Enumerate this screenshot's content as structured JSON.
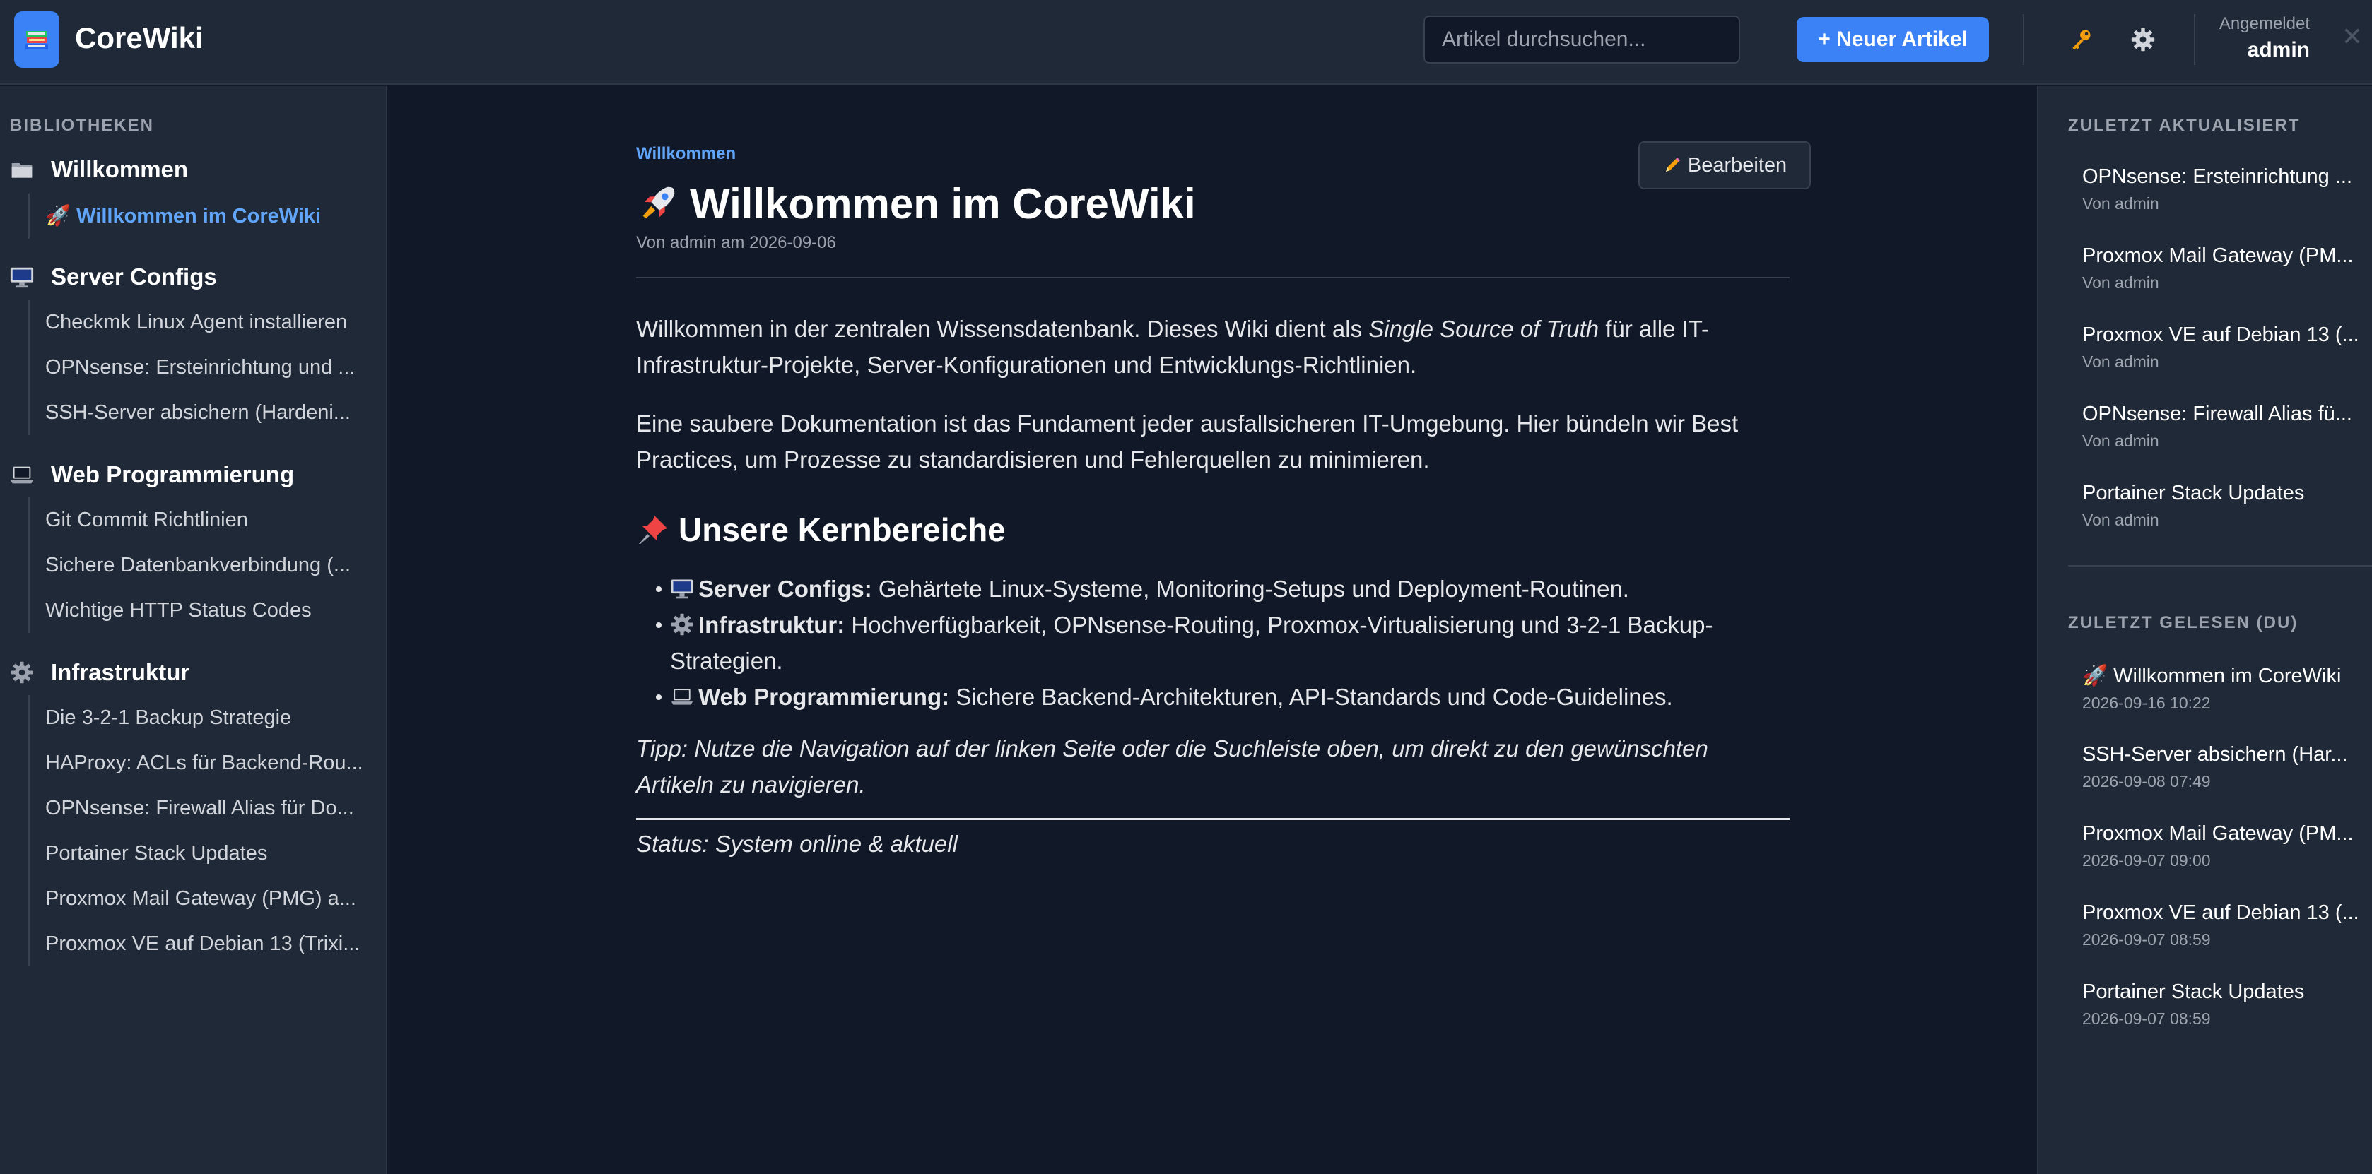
{
  "header": {
    "app_title": "CoreWiki",
    "search_placeholder": "Artikel durchsuchen...",
    "new_article_label": "+ Neuer Artikel",
    "user_caption": "Angemeldet",
    "user_name": "admin",
    "close_glyph": "✕",
    "icons": [
      "books-logo-icon",
      "key-icon",
      "gear-icon",
      "close-icon"
    ]
  },
  "sidebar": {
    "heading": "BIBLIOTHEKEN",
    "libraries": [
      {
        "title": "Willkommen",
        "icon": "folder-icon",
        "items": [
          {
            "label": "🚀 Willkommen im CoreWiki",
            "active": true
          }
        ]
      },
      {
        "title": "Server Configs",
        "icon": "desktop-icon",
        "items": [
          {
            "label": "Checkmk Linux Agent installieren"
          },
          {
            "label": "OPNsense: Ersteinrichtung und ..."
          },
          {
            "label": "SSH-Server absichern (Hardeni..."
          }
        ]
      },
      {
        "title": "Web Programmierung",
        "icon": "laptop-icon",
        "items": [
          {
            "label": "Git Commit Richtlinien"
          },
          {
            "label": "Sichere Datenbankverbindung (..."
          },
          {
            "label": "Wichtige HTTP Status Codes"
          }
        ]
      },
      {
        "title": "Infrastruktur",
        "icon": "gear-icon",
        "items": [
          {
            "label": "Die 3-2-1 Backup Strategie"
          },
          {
            "label": "HAProxy: ACLs für Backend-Rou..."
          },
          {
            "label": "OPNsense: Firewall Alias für Do..."
          },
          {
            "label": "Portainer Stack Updates"
          },
          {
            "label": "Proxmox Mail Gateway (PMG) a..."
          },
          {
            "label": "Proxmox VE auf Debian 13 (Trixi..."
          }
        ]
      }
    ]
  },
  "article": {
    "breadcrumb": "Willkommen",
    "edit_label": "Bearbeiten",
    "title": "Willkommen im CoreWiki",
    "meta": "Von admin am 2026-09-06",
    "p1_before": "Willkommen in der zentralen Wissensdatenbank. Dieses Wiki dient als ",
    "p1_em": "Single Source of Truth",
    "p1_after": " für alle IT-Infrastruktur-Projekte, Server-Konfigurationen und Entwicklungs-Richtlinien.",
    "p2": "Eine saubere Dokumentation ist das Fundament jeder ausfallsicheren IT-Umgebung. Hier bündeln wir Best Practices, um Prozesse zu standardisieren und Fehlerquellen zu minimieren.",
    "h2": "Unsere Kernbereiche",
    "bullets": [
      {
        "icon": "desktop-icon",
        "label": "Server Configs:",
        "text": " Gehärtete Linux-Systeme, Monitoring-Setups und Deployment-Routinen."
      },
      {
        "icon": "gear-icon",
        "label": "Infrastruktur:",
        "text": " Hochverfügbarkeit, OPNsense-Routing, Proxmox-Virtualisierung und 3-2-1 Backup-Strategien."
      },
      {
        "icon": "laptop-icon",
        "label": "Web Programmierung:",
        "text": " Sichere Backend-Architekturen, API-Standards und Code-Guidelines."
      }
    ],
    "tip": "Tipp: Nutze die Navigation auf der linken Seite oder die Suchleiste oben, um direkt zu den gewünschten Artikeln zu navigieren.",
    "status": "Status: System online & aktuell"
  },
  "right": {
    "updated_heading": "ZULETZT AKTUALISIERT",
    "updated": [
      {
        "title": "OPNsense: Ersteinrichtung ...",
        "sub": "Von admin"
      },
      {
        "title": "Proxmox Mail Gateway (PM...",
        "sub": "Von admin"
      },
      {
        "title": "Proxmox VE auf Debian 13 (...",
        "sub": "Von admin"
      },
      {
        "title": "OPNsense: Firewall Alias fü...",
        "sub": "Von admin"
      },
      {
        "title": "Portainer Stack Updates",
        "sub": "Von admin"
      }
    ],
    "read_heading": "ZULETZT GELESEN (DU)",
    "read": [
      {
        "title": "🚀 Willkommen im CoreWiki",
        "sub": "2026-09-16 10:22"
      },
      {
        "title": "SSH-Server absichern (Har...",
        "sub": "2026-09-08 07:49"
      },
      {
        "title": "Proxmox Mail Gateway (PM...",
        "sub": "2026-09-07 09:00"
      },
      {
        "title": "Proxmox VE auf Debian 13 (...",
        "sub": "2026-09-07 08:59"
      },
      {
        "title": "Portainer Stack Updates",
        "sub": "2026-09-07 08:59"
      }
    ]
  },
  "colors": {
    "background": "#111827",
    "panel": "#1f2937",
    "accent": "#3b82f6",
    "link": "#60a5fa",
    "muted": "#9ca3af"
  }
}
